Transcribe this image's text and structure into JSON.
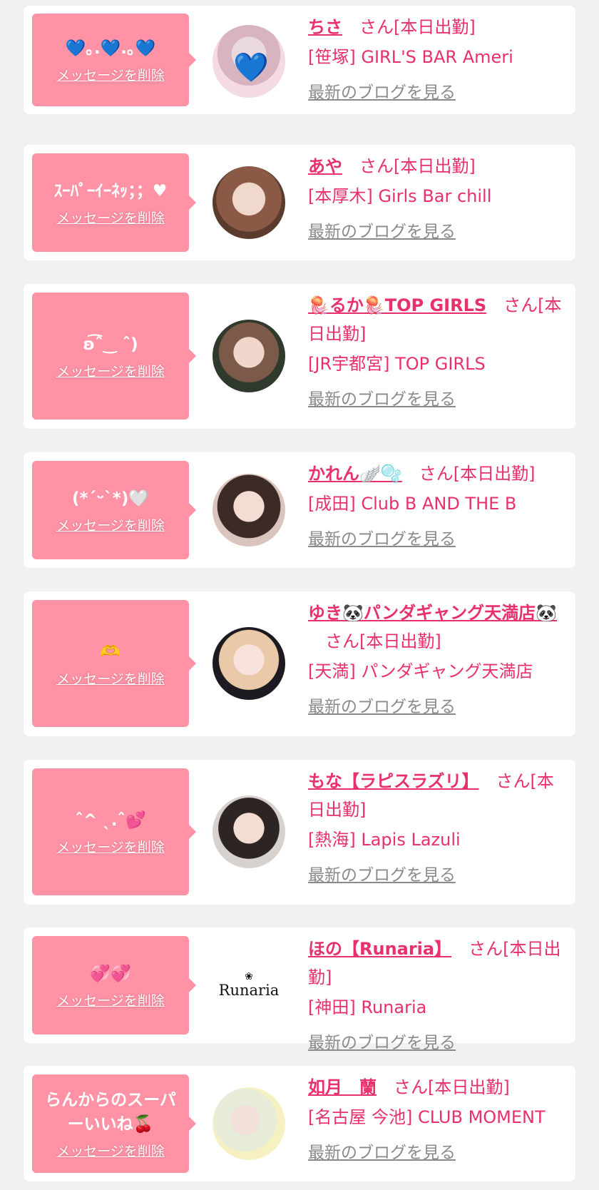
{
  "delete_label": "メッセージを削除",
  "blog_label": "最新のブログを見る",
  "san_label": "さん[本日出勤]",
  "colors": {
    "bubble": "#ff92a5",
    "accent": "#e8306a",
    "card": "#ffffff",
    "background": "#f3f1ef",
    "blog_link": "#8a8a8a"
  },
  "items": [
    {
      "message": "💙｡.💙.｡💙",
      "name": "ちさ",
      "shop": "[笹塚] GIRL'S BAR Ameri"
    },
    {
      "message": "ｽｰﾊﾟｰｲｰﾈｯ；；♥",
      "name": "あや",
      "shop": "[本厚木] Girls Bar chill"
    },
    {
      "message": "ʚ͡ˆ‿ ˆ)",
      "name": "🪼るか🪼TOP GIRLS",
      "shop": "[JR宇都宮] TOP GIRLS"
    },
    {
      "message": "(*ˊᵕˋ*)🤍",
      "name": "かれん🪽🫧",
      "shop": "[成田] Club B AND THE B"
    },
    {
      "message": "🫶",
      "name": "ゆき🐼パンダギャング天満店🐼",
      "shop": "[天満] パンダギャング天満店"
    },
    {
      "message": "ˆ^ ˎ.ˆ💕",
      "name": "もな【ラピスラズリ】",
      "shop": "[熱海] Lapis Lazuli"
    },
    {
      "message": "💞💞",
      "name": "ほの【Runaria】",
      "shop": "[神田] Runaria",
      "logo_text": "Runaria"
    },
    {
      "message": "らんからのスーパーいいね🍒",
      "name": "如月　蘭",
      "shop": "[名古屋 今池] CLUB MOMENT"
    }
  ]
}
